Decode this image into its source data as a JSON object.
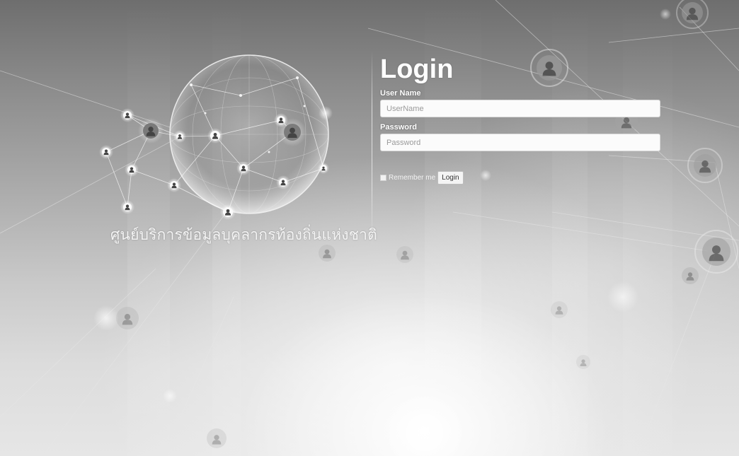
{
  "brand": {
    "title": "ศูนย์บริการข้อมูลบุคลากรท้องถิ่นแห่งชาติ",
    "globe_icon": "network-globe-icon",
    "people_icon": "user-node-icon"
  },
  "login": {
    "heading": "Login",
    "username_label": "User Name",
    "username_placeholder": "UserName",
    "username_value": "",
    "password_label": "Password",
    "password_placeholder": "Password",
    "password_value": "",
    "remember_label": "Remember me",
    "remember_checked": false,
    "submit_label": "Login"
  },
  "colors": {
    "background_dark": "#6e6e6e",
    "background_light": "#e6e6e6",
    "text": "#ffffff",
    "input_bg": "#fbfbfb"
  }
}
